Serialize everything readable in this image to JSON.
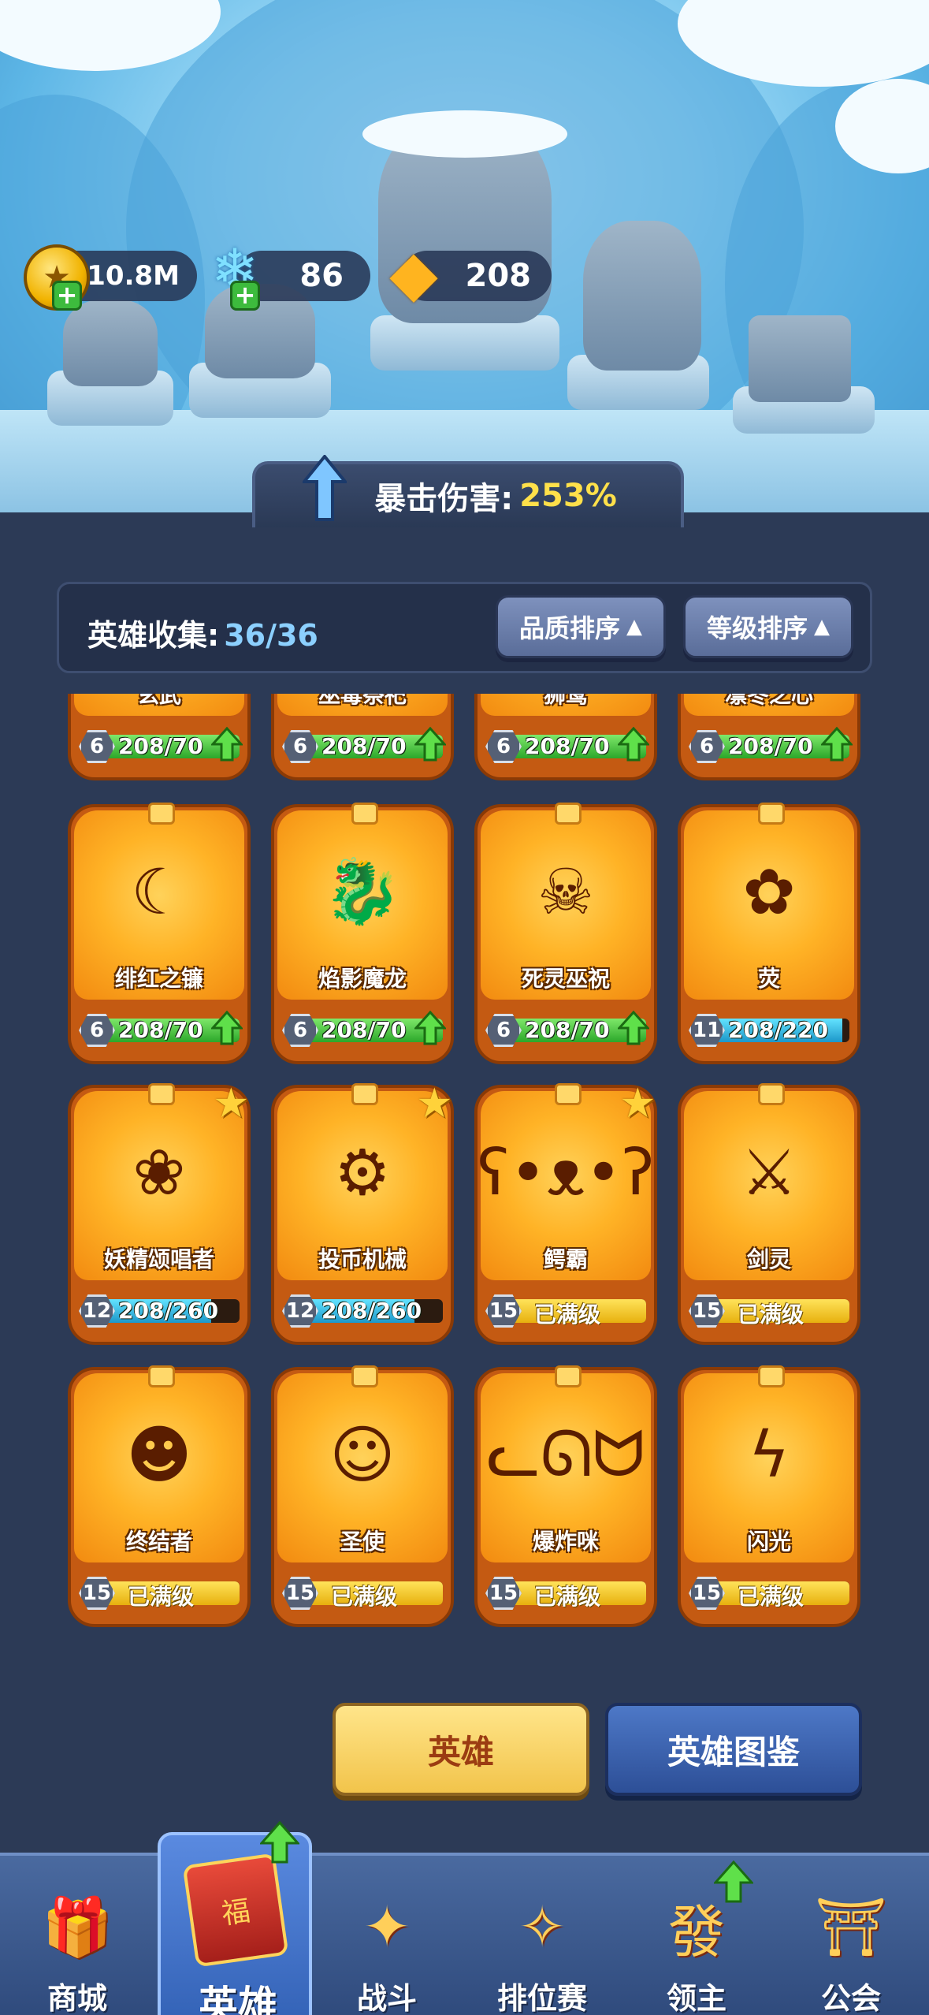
{
  "currency": {
    "gold": "10.8M",
    "gems": "86",
    "crystals": "208"
  },
  "crit": {
    "label": "暴击伤害:",
    "value": "253%"
  },
  "collection": {
    "label": "英雄收集:",
    "count": "36/36"
  },
  "sort": {
    "quality": "品质排序",
    "level": "等级排序",
    "arrow": "▲"
  },
  "heroes": [
    {
      "name": "玄武",
      "level": "6",
      "progress": "208/70",
      "fraction": 1.0,
      "bar": "green",
      "upgrade": true,
      "star": false
    },
    {
      "name": "巫毒祭祀",
      "level": "6",
      "progress": "208/70",
      "fraction": 1.0,
      "bar": "green",
      "upgrade": true,
      "star": false
    },
    {
      "name": "狮鹫",
      "level": "6",
      "progress": "208/70",
      "fraction": 1.0,
      "bar": "green",
      "upgrade": true,
      "star": false
    },
    {
      "name": "凛冬之心",
      "level": "6",
      "progress": "208/70",
      "fraction": 1.0,
      "bar": "green",
      "upgrade": true,
      "star": false
    },
    {
      "name": "绯红之镰",
      "level": "6",
      "progress": "208/70",
      "fraction": 1.0,
      "bar": "green",
      "upgrade": true,
      "star": false,
      "icon": "scythe-icon",
      "glyph": "☾"
    },
    {
      "name": "焰影魔龙",
      "level": "6",
      "progress": "208/70",
      "fraction": 1.0,
      "bar": "green",
      "upgrade": true,
      "star": false,
      "icon": "dragon-icon",
      "glyph": "🐉"
    },
    {
      "name": "死灵巫祝",
      "level": "6",
      "progress": "208/70",
      "fraction": 1.0,
      "bar": "green",
      "upgrade": true,
      "star": false,
      "icon": "skull-icon",
      "glyph": "☠"
    },
    {
      "name": "荧",
      "level": "11",
      "progress": "208/220",
      "fraction": 0.95,
      "bar": "cyan",
      "upgrade": false,
      "star": false,
      "icon": "fairy-icon",
      "glyph": "✿"
    },
    {
      "name": "妖精颂唱者",
      "level": "12",
      "progress": "208/260",
      "fraction": 0.8,
      "bar": "cyan",
      "upgrade": false,
      "star": true,
      "icon": "singer-icon",
      "glyph": "❀"
    },
    {
      "name": "投币机械",
      "level": "12",
      "progress": "208/260",
      "fraction": 0.8,
      "bar": "cyan",
      "upgrade": false,
      "star": true,
      "icon": "slot-machine-icon",
      "glyph": "⚙"
    },
    {
      "name": "鳄霸",
      "level": "15",
      "progress": "已满级",
      "fraction": 1.0,
      "bar": "gold",
      "upgrade": false,
      "star": true,
      "icon": "bear-icon",
      "glyph": "ʕ•ᴥ•ʔ"
    },
    {
      "name": "剑灵",
      "level": "15",
      "progress": "已满级",
      "fraction": 1.0,
      "bar": "gold",
      "upgrade": false,
      "star": false,
      "icon": "sword-spirit-icon",
      "glyph": "⚔"
    },
    {
      "name": "终结者",
      "level": "15",
      "progress": "已满级",
      "fraction": 1.0,
      "bar": "gold",
      "upgrade": false,
      "star": false,
      "icon": "gunner-icon",
      "glyph": "☻"
    },
    {
      "name": "圣使",
      "level": "15",
      "progress": "已满级",
      "fraction": 1.0,
      "bar": "gold",
      "upgrade": false,
      "star": false,
      "icon": "angel-icon",
      "glyph": "☺"
    },
    {
      "name": "爆炸咪",
      "level": "15",
      "progress": "已满级",
      "fraction": 1.0,
      "bar": "gold",
      "upgrade": false,
      "star": false,
      "icon": "cat-icon",
      "glyph": "ᓚᘏᗢ"
    },
    {
      "name": "闪光",
      "level": "15",
      "progress": "已满级",
      "fraction": 1.0,
      "bar": "gold",
      "upgrade": false,
      "star": false,
      "icon": "lightning-icon",
      "glyph": "ϟ"
    }
  ],
  "buttons": {
    "hero": "英雄",
    "dex": "英雄图鉴"
  },
  "nav": [
    {
      "label": "商城",
      "icon": "shop-chest-icon",
      "glyph": "🎁"
    },
    {
      "label": "英雄",
      "icon": "hero-cards-icon",
      "glyph": "福"
    },
    {
      "label": "战斗",
      "icon": "battle-cannon-icon",
      "glyph": "✦"
    },
    {
      "label": "排位赛",
      "icon": "ranked-knot-icon",
      "glyph": "✧"
    },
    {
      "label": "领主",
      "icon": "lord-scroll-icon",
      "glyph": "發"
    },
    {
      "label": "公会",
      "icon": "guild-pagoda-icon",
      "glyph": "⛩"
    }
  ]
}
